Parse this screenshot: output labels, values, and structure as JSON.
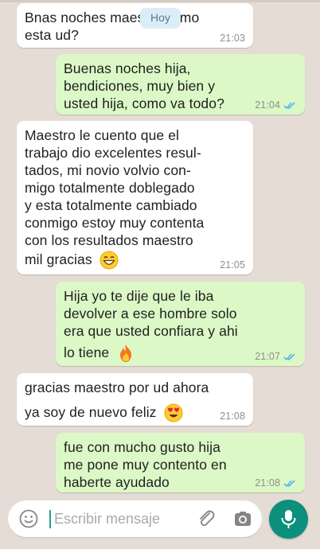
{
  "day_chip": "Hoy",
  "messages": [
    {
      "dir": "in",
      "lines": [
        "Bnas noches maestro como",
        "esta ud?"
      ],
      "time": "21:03",
      "emoji": ""
    },
    {
      "dir": "out",
      "lines": [
        "Buenas noches hija,",
        "bendiciones, muy bien y",
        "usted hija, como va todo?"
      ],
      "time": "21:04",
      "emoji": ""
    },
    {
      "dir": "in",
      "lines": [
        "Maestro le cuento que el",
        "trabajo dio excelentes resul-",
        "tados, mi novio volvio con-",
        "migo totalmente doblegado",
        "y esta totalmente cambiado",
        "conmigo estoy muy contenta",
        "con los resultados maestro",
        "mil gracias"
      ],
      "time": "21:05",
      "emoji": "grinning-face-emoji"
    },
    {
      "dir": "out",
      "lines": [
        "Hija yo te dije que le iba",
        "devolver a ese hombre solo",
        "era que usted confiara y ahi",
        "lo tiene"
      ],
      "time": "21:07",
      "emoji": "fire-emoji"
    },
    {
      "dir": "in",
      "lines": [
        "gracias maestro por ud ahora",
        "ya soy de nuevo feliz"
      ],
      "time": "21:08",
      "emoji": "heart-eyes-emoji"
    },
    {
      "dir": "out",
      "lines": [
        "fue con mucho gusto hija",
        "me pone muy contento en",
        "haberte ayudado"
      ],
      "time": "21:08",
      "emoji": ""
    }
  ],
  "composer": {
    "placeholder": "Escribir mensaje",
    "icons": [
      "smile-icon",
      "paperclip-icon",
      "camera-icon",
      "mic-icon"
    ]
  },
  "colors": {
    "background": "#e5ddd5",
    "incoming": "#ffffff",
    "outgoing": "#dcf8c6",
    "read_ticks": "#4fb6ec",
    "send_button": "#0d8f7d"
  }
}
